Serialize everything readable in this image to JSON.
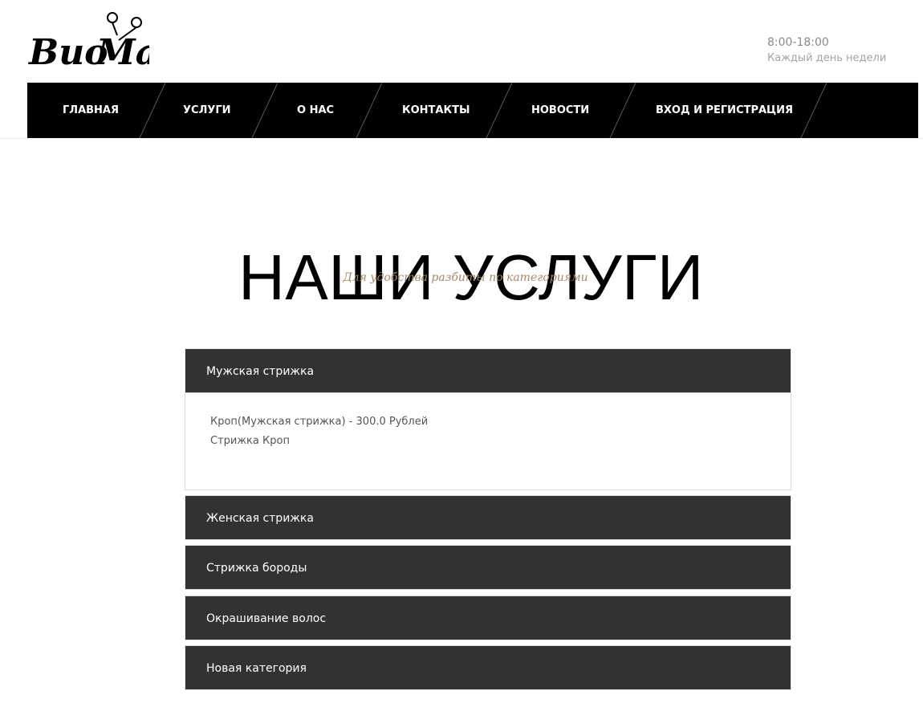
{
  "brand": {
    "logo_text": "ВиоМа"
  },
  "hours": {
    "time": "8:00-18:00",
    "days": "Каждый день недели"
  },
  "nav": {
    "items": [
      "ГЛАВНАЯ",
      "УСЛУГИ",
      "О НАС",
      "КОНТАКТЫ",
      "НОВОСТИ",
      "ВХОД И РЕГИСТРАЦИЯ"
    ]
  },
  "main": {
    "title": "НАШИ УСЛУГИ",
    "subtitle": "Для удобства разбиты по категориями"
  },
  "categories": [
    {
      "name": "Мужская стрижка",
      "expanded": true,
      "services": [
        {
          "title": "Кроп(Мужская стрижка) - 300.0 Рублей",
          "description": "Стрижка Кроп"
        }
      ]
    },
    {
      "name": "Женская стрижка",
      "expanded": false
    },
    {
      "name": "Стрижка бороды",
      "expanded": false
    },
    {
      "name": "Окрашивание волос",
      "expanded": false
    },
    {
      "name": "Новая категория",
      "expanded": false
    }
  ],
  "colors": {
    "nav_background": "#000000",
    "accordion_header": "#323232",
    "subtitle": "#a38a6a",
    "hours_text": "#8a8a8a"
  }
}
